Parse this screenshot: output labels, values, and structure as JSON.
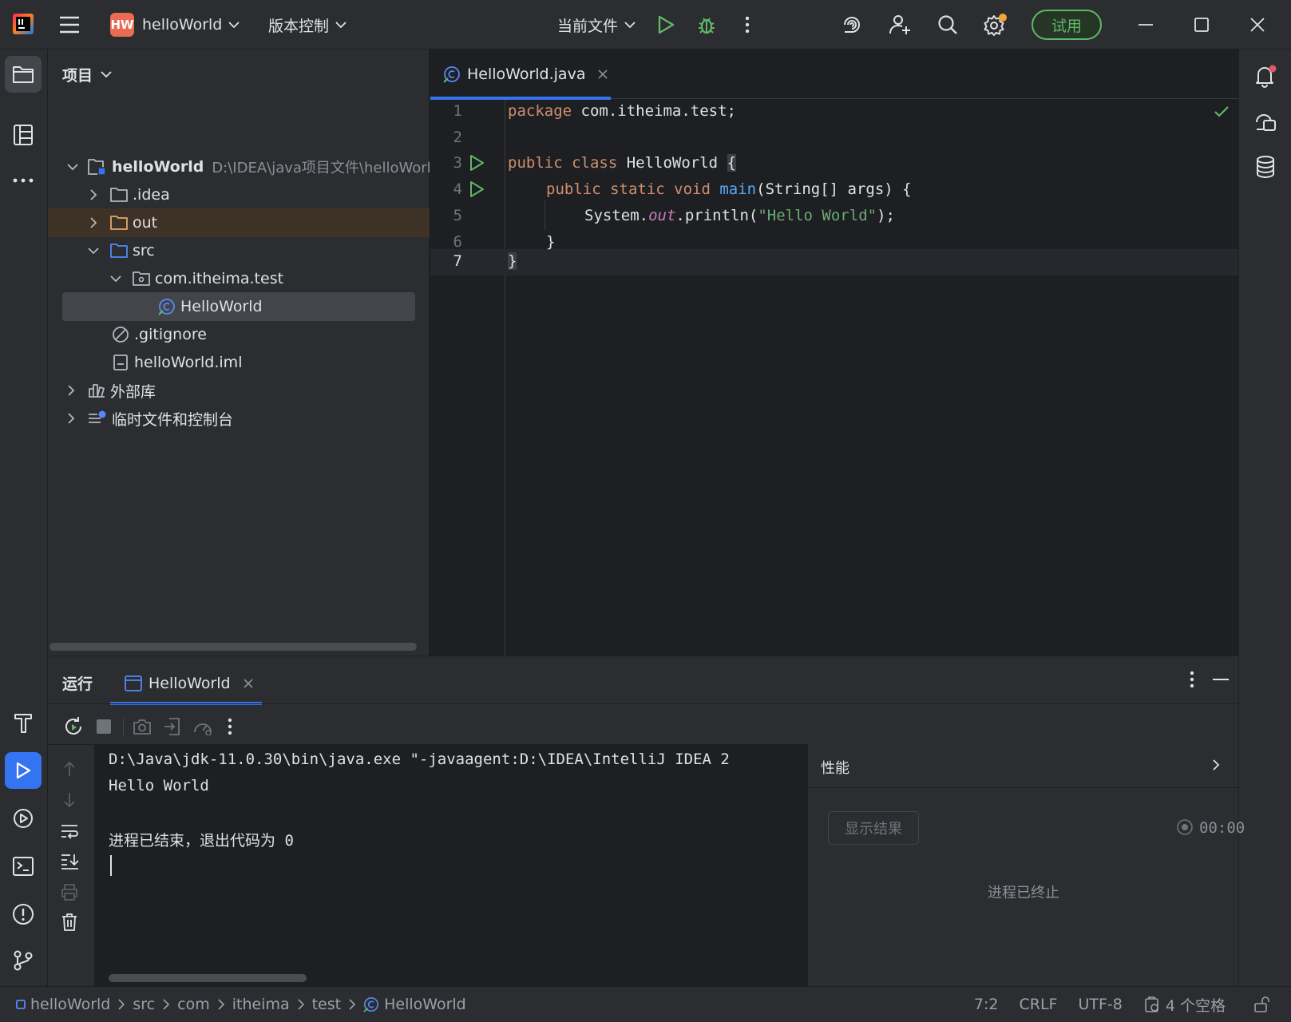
{
  "titlebar": {
    "project_badge": "HW",
    "project_name": "helloWorld",
    "vcs_menu": "版本控制",
    "run_config": "当前文件",
    "trial_button": "试用"
  },
  "project_panel": {
    "title": "项目",
    "root_name": "helloWorld",
    "root_path": "D:\\IDEA\\java项目文件\\helloWorld",
    "items": [
      {
        "label": ".idea"
      },
      {
        "label": "out"
      },
      {
        "label": "src"
      },
      {
        "label": "com.itheima.test"
      },
      {
        "label": "HelloWorld"
      },
      {
        "label": ".gitignore"
      },
      {
        "label": "helloWorld.iml"
      },
      {
        "label": "外部库"
      },
      {
        "label": "临时文件和控制台"
      }
    ]
  },
  "editor": {
    "tab_label": "HelloWorld.java",
    "line_numbers": [
      "1",
      "2",
      "3",
      "4",
      "5",
      "6",
      "7"
    ],
    "code": {
      "l1_kw": "package",
      "l1_rest": " com.itheima.test;",
      "l3_kw": "public class",
      "l3_name": " HelloWorld ",
      "l3_brace": "{",
      "l4_kw": "public static void",
      "l4_fn": "main",
      "l4_rest": "(String[] args) {",
      "l5_a": "System.",
      "l5_b": "out",
      "l5_c": ".println(",
      "l5_str": "\"Hello World\"",
      "l5_d": ");",
      "l6": "}",
      "l7": "}"
    }
  },
  "run_panel": {
    "title": "运行",
    "tab_label": "HelloWorld",
    "console_lines": [
      "D:\\Java\\jdk-11.0.30\\bin\\java.exe \"-javaagent:D:\\IDEA\\IntelliJ IDEA 2",
      "Hello World",
      "",
      "进程已结束，退出代码为 0"
    ],
    "perf_title": "性能",
    "show_results_button": "显示结果",
    "timer": "00:00",
    "process_status": "进程已终止"
  },
  "statusbar": {
    "breadcrumbs": [
      "helloWorld",
      "src",
      "com",
      "itheima",
      "test",
      "HelloWorld"
    ],
    "position": "7:2",
    "line_ending": "CRLF",
    "encoding": "UTF-8",
    "indent": "4 个空格"
  },
  "colors": {
    "accent": "#3574f0",
    "run_green": "#5fb865",
    "keyword": "#cf8e6d",
    "function": "#56a8f5",
    "string": "#6aab73",
    "static_field": "#c77dbb",
    "background": "#1e1f22",
    "panel": "#2b2d30"
  }
}
